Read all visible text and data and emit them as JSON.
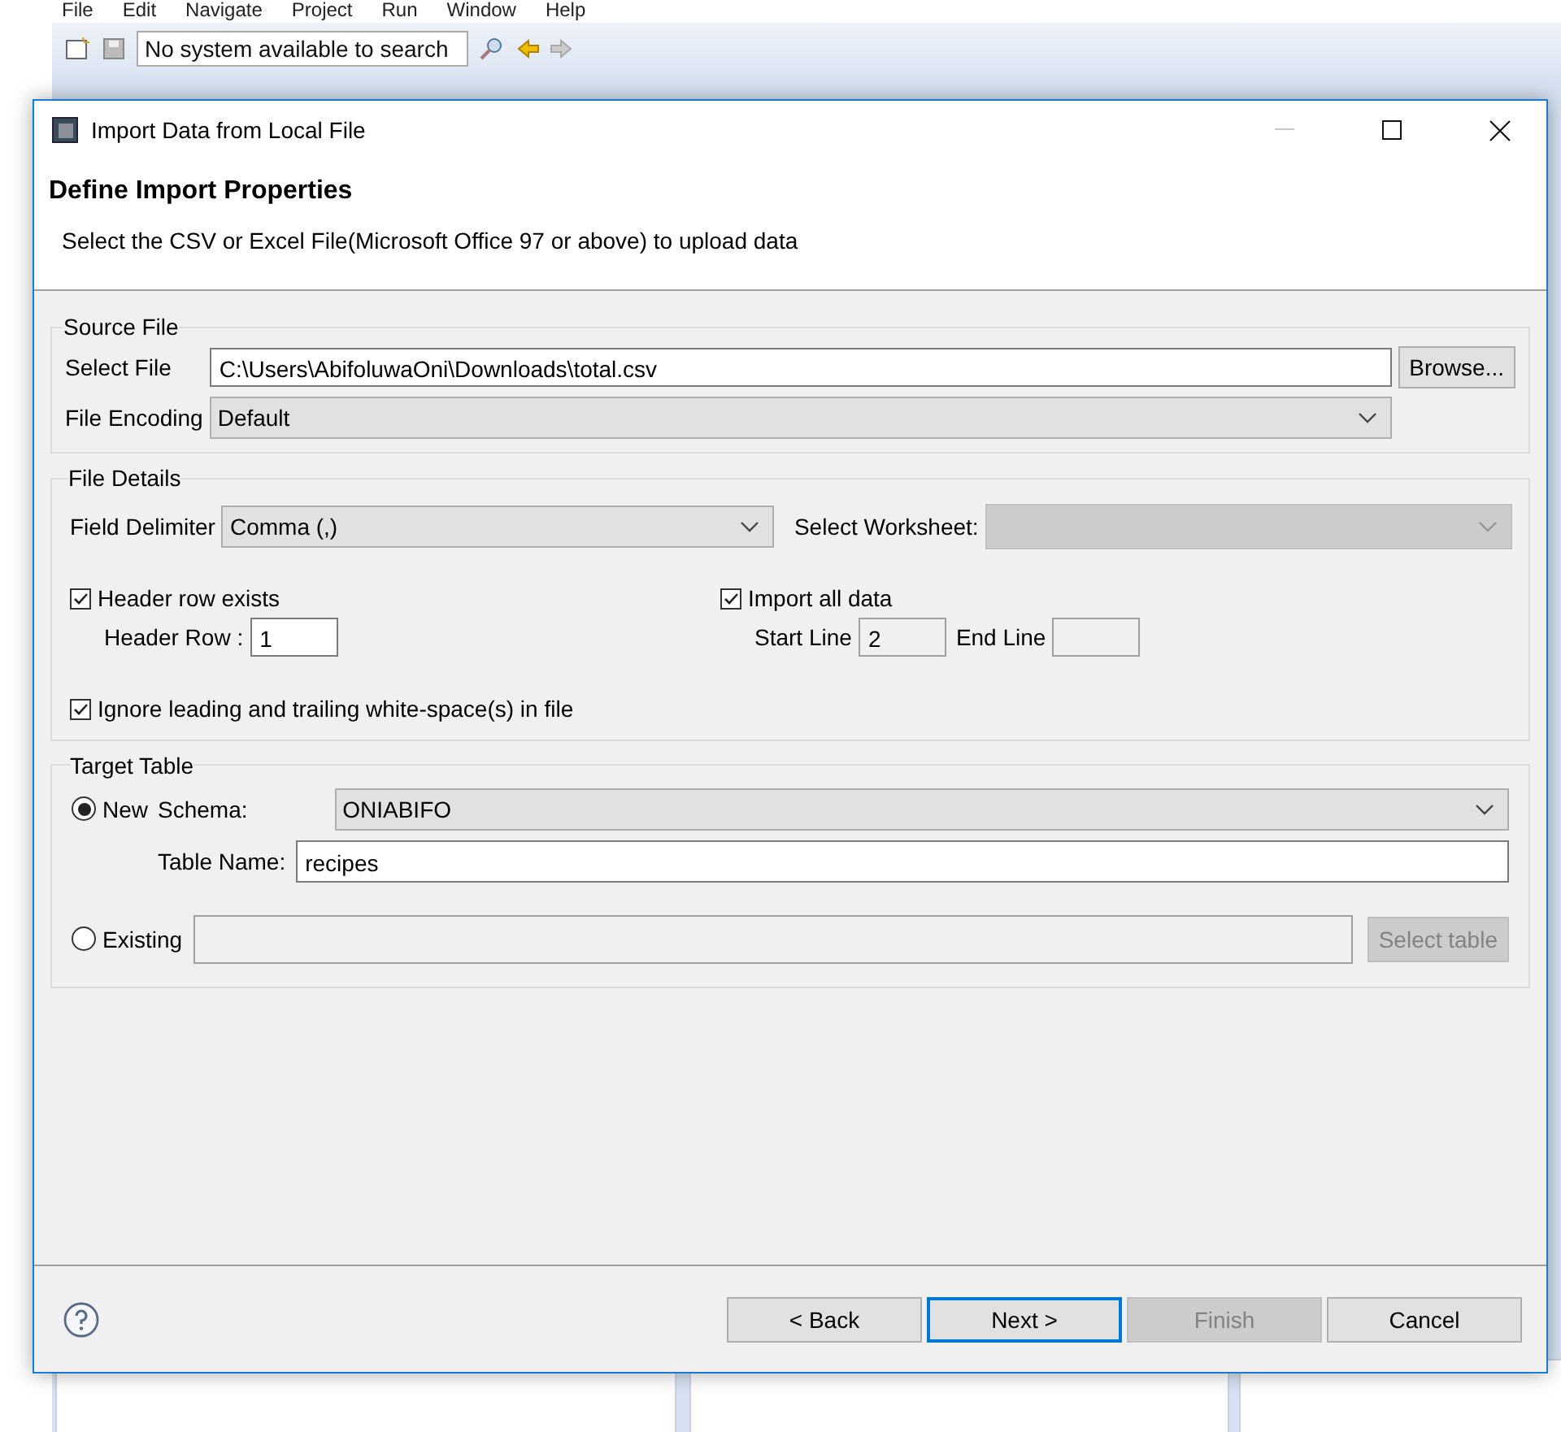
{
  "workbench": {
    "menu": [
      "File",
      "Edit",
      "Navigate",
      "Project",
      "Run",
      "Window",
      "Help"
    ],
    "search": {
      "value": "No system available to search"
    }
  },
  "dialog": {
    "title": "Import Data from Local File",
    "heading": "Define Import Properties",
    "description": "Select the CSV or Excel File(Microsoft Office 97 or above) to upload data",
    "source_file": {
      "legend": "Source File",
      "select_file_label": "Select File",
      "file_path": "C:\\Users\\AbifoluwaOni\\Downloads\\total.csv",
      "browse_button": "Browse...",
      "encoding_label": "File Encoding",
      "encoding": "Default"
    },
    "file_details": {
      "legend": "File Details",
      "delimiter_label": "Field Delimiter",
      "delimiter": "Comma (,)",
      "worksheet_label": "Select Worksheet:",
      "worksheet_disabled": true,
      "header_row_exists": {
        "label": "Header row exists",
        "checked": true
      },
      "header_row_label": "Header Row :",
      "header_row": "1",
      "import_all": {
        "label": "Import all data",
        "checked": true
      },
      "start_line_label": "Start Line",
      "start_line": "2",
      "end_line_label": "End Line",
      "ignore_whitespace": {
        "label": "Ignore leading and trailing white-space(s) in file",
        "checked": true
      }
    },
    "target_table": {
      "legend": "Target Table",
      "options": [
        {
          "label": "New",
          "selected": true
        },
        {
          "label": "Existing",
          "selected": false
        }
      ],
      "schema_label": "Schema:",
      "schema": "ONIABIFO",
      "table_name_label": "Table Name:",
      "table_name": "recipes",
      "select_table_button": {
        "label": "Select table",
        "disabled": true
      }
    },
    "buttons": [
      {
        "label": "< Back",
        "disabled": false,
        "default": false
      },
      {
        "label": "Next >",
        "disabled": false,
        "default": true
      },
      {
        "label": "Finish",
        "disabled": true,
        "default": false
      },
      {
        "label": "Cancel",
        "disabled": false,
        "default": false
      }
    ]
  }
}
